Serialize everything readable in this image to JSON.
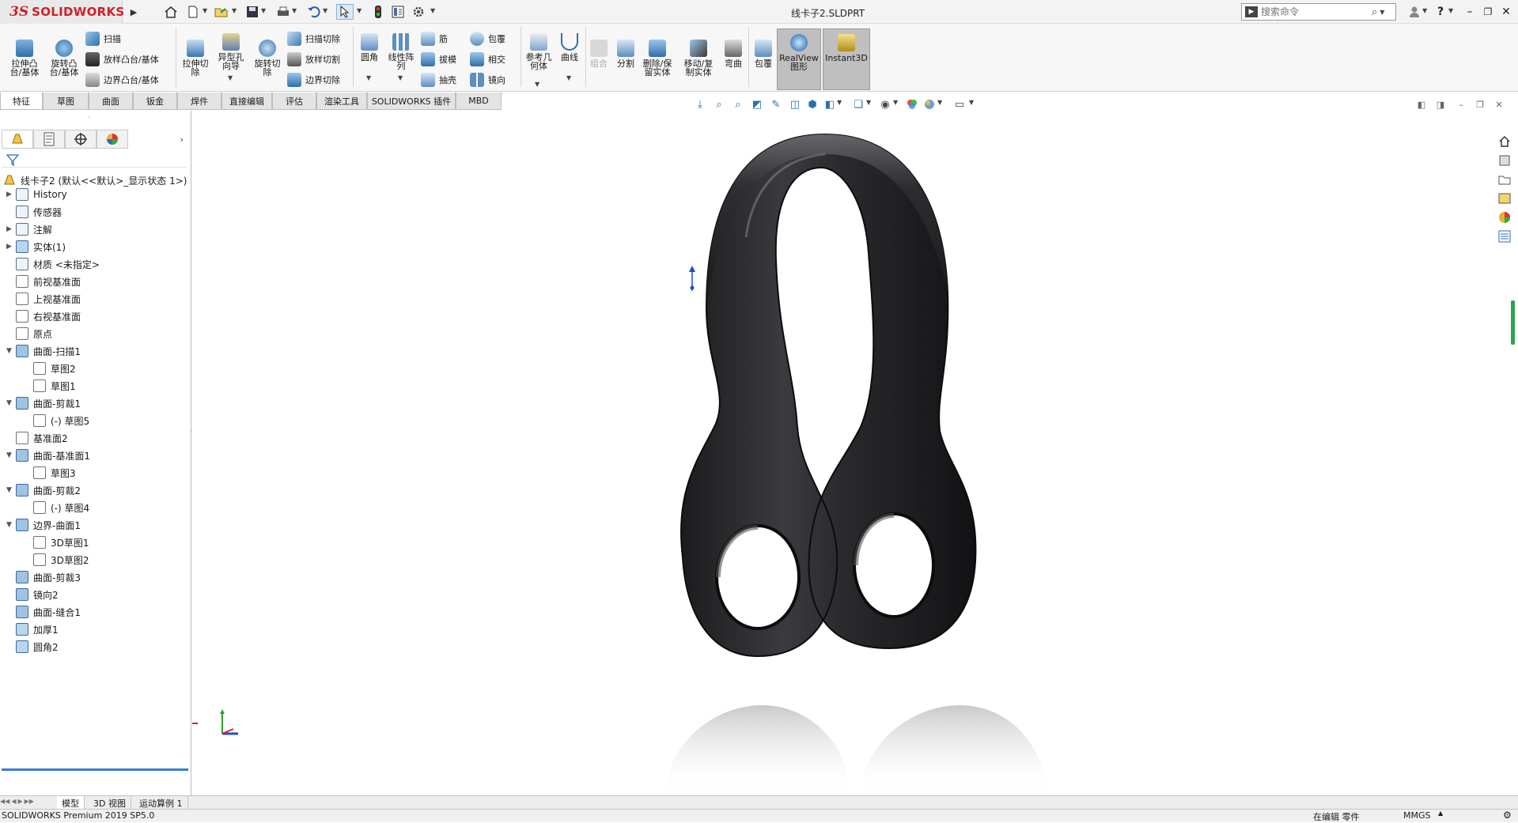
{
  "app": {
    "logo_ds": "3S",
    "logo_name": "SOLIDWORKS",
    "document_title": "线卡子2.SLDPRT",
    "search_placeholder": "搜索命令",
    "accent": "#d0202a"
  },
  "quick_access": {
    "icons": [
      "home-icon",
      "new-document-icon",
      "open-icon",
      "save-icon",
      "print-icon",
      "undo-icon",
      "select-icon",
      "rebuild-icon",
      "file-properties-icon",
      "options-icon"
    ]
  },
  "ribbon": {
    "features": {
      "extrude_boss": "拉伸凸\n台/基体",
      "revolve_boss": "旋转凸\n台/基体",
      "sweep": "扫描",
      "loft_boss": "放样凸台/基体",
      "boundary_boss": "边界凸台/基体",
      "extrude_cut": "拉伸切\n除",
      "hole_wizard": "异型孔\n向导",
      "revolve_cut": "旋转切\n除",
      "sweep_cut": "扫描切除",
      "loft_cut": "放样切割",
      "boundary_cut": "边界切除",
      "fillet": "圆角",
      "linear_pattern": "线性阵\n列",
      "rib": "筋",
      "draft": "拔模",
      "shell": "抽壳",
      "wrap": "包覆",
      "intersect": "相交",
      "mirror": "镜向",
      "reference_geometry": "参考几\n何体",
      "curves": "曲线",
      "combine": "组合",
      "split": "分割",
      "delete_keep_body": "删除/保\n留实体",
      "move_copy_body": "移动/复\n制实体",
      "flex": "弯曲",
      "wrap2": "包覆",
      "realview": "RealView\n图形",
      "instant3d": "Instant3D"
    }
  },
  "tabs": [
    "特征",
    "草图",
    "曲面",
    "钣金",
    "焊件",
    "直接编辑",
    "评估",
    "渲染工具",
    "SOLIDWORKS 插件",
    "MBD"
  ],
  "feature_tree": {
    "root": "线卡子2  (默认<<默认>_显示状态 1>)",
    "items": [
      {
        "label": "History",
        "level": 1,
        "arrow": "▶",
        "icon": "history-icon"
      },
      {
        "label": "传感器",
        "level": 1,
        "arrow": "",
        "icon": "sensor-icon"
      },
      {
        "label": "注解",
        "level": 1,
        "arrow": "▶",
        "icon": "annotation-icon"
      },
      {
        "label": "实体(1)",
        "level": 1,
        "arrow": "▶",
        "icon": "solid-bodies-icon"
      },
      {
        "label": "材质 <未指定>",
        "level": 1,
        "arrow": "",
        "icon": "material-icon"
      },
      {
        "label": "前视基准面",
        "level": 1,
        "arrow": "",
        "icon": "plane-icon"
      },
      {
        "label": "上视基准面",
        "level": 1,
        "arrow": "",
        "icon": "plane-icon"
      },
      {
        "label": "右视基准面",
        "level": 1,
        "arrow": "",
        "icon": "plane-icon"
      },
      {
        "label": "原点",
        "level": 1,
        "arrow": "",
        "icon": "origin-icon"
      },
      {
        "label": "曲面-扫描1",
        "level": 1,
        "arrow": "▼",
        "icon": "surface-sweep-icon"
      },
      {
        "label": "草图2",
        "level": 2,
        "arrow": "",
        "icon": "sketch-icon"
      },
      {
        "label": "草图1",
        "level": 2,
        "arrow": "",
        "icon": "sketch-icon"
      },
      {
        "label": "曲面-剪裁1",
        "level": 1,
        "arrow": "▼",
        "icon": "surface-trim-icon"
      },
      {
        "label": "(-) 草图5",
        "level": 2,
        "arrow": "",
        "icon": "sketch-icon"
      },
      {
        "label": "基准面2",
        "level": 1,
        "arrow": "",
        "icon": "plane-icon"
      },
      {
        "label": "曲面-基准面1",
        "level": 1,
        "arrow": "▼",
        "icon": "surface-plane-icon"
      },
      {
        "label": "草图3",
        "level": 2,
        "arrow": "",
        "icon": "sketch-icon"
      },
      {
        "label": "曲面-剪裁2",
        "level": 1,
        "arrow": "▼",
        "icon": "surface-trim-icon"
      },
      {
        "label": "(-) 草图4",
        "level": 2,
        "arrow": "",
        "icon": "sketch-icon"
      },
      {
        "label": "边界-曲面1",
        "level": 1,
        "arrow": "▼",
        "icon": "boundary-surface-icon"
      },
      {
        "label": "3D草图1",
        "level": 2,
        "arrow": "",
        "icon": "3d-sketch-icon"
      },
      {
        "label": "3D草图2",
        "level": 2,
        "arrow": "",
        "icon": "3d-sketch-icon"
      },
      {
        "label": "曲面-剪裁3",
        "level": 1,
        "arrow": "",
        "icon": "surface-trim-icon"
      },
      {
        "label": "镜向2",
        "level": 1,
        "arrow": "",
        "icon": "mirror-icon"
      },
      {
        "label": "曲面-缝合1",
        "level": 1,
        "arrow": "",
        "icon": "surface-knit-icon"
      },
      {
        "label": "加厚1",
        "level": 1,
        "arrow": "",
        "icon": "thicken-icon"
      },
      {
        "label": "圆角2",
        "level": 1,
        "arrow": "",
        "icon": "fillet-icon"
      }
    ]
  },
  "bottom_tabs": [
    "模型",
    "3D 视图",
    "运动算例 1"
  ],
  "status": {
    "product": "SOLIDWORKS Premium 2019 SP5.0",
    "editing": "在编辑 零件",
    "units": "MMGS"
  }
}
